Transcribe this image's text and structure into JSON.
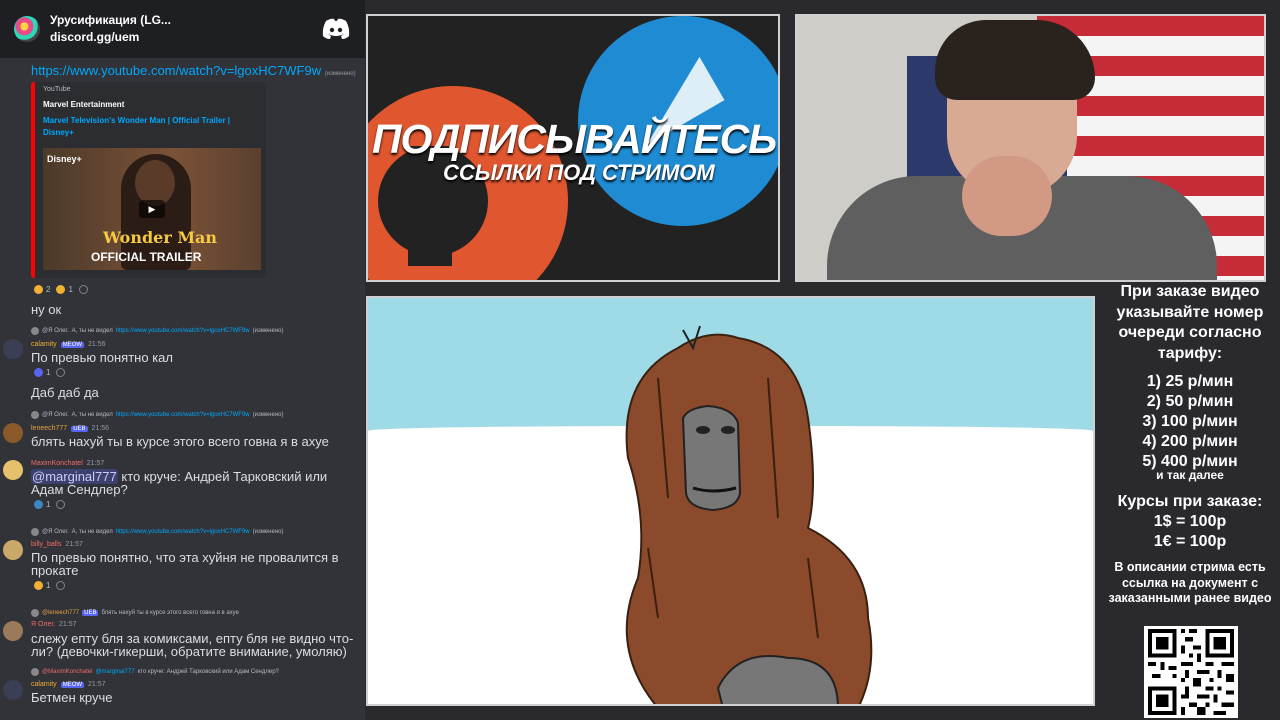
{
  "server": {
    "name": "Урусификация (LG...",
    "link": "discord.gg/uem",
    "icon": "discord-icon"
  },
  "chat": {
    "top_url": "https://www.youtube.com/watch?v=lgoxHC7WF9w",
    "top_url_suffix": "(изменено)",
    "embed": {
      "provider": "YouTube",
      "author": "Marvel Entertainment",
      "title": "Marvel Television's Wonder Man | Official Trailer | Disney+",
      "thumb_brand": "Disney+",
      "thumb_title": "Wonder Man",
      "thumb_sub": "OFFICIAL TRAILER"
    },
    "reactions_1": [
      {
        "count": "2"
      },
      {
        "count": "1"
      }
    ],
    "messages": [
      {
        "text": "ну ок"
      },
      {
        "reply_user": "@Я Олег.",
        "reply_text": "А, ты не видел",
        "reply_link": "https://www.youtube.com/watch?v=lgoxHC7WF9w",
        "reply_suffix": "(изменено)",
        "user": "calamity",
        "badge": "MEOW",
        "time": "21:56",
        "text": "По превью понятно кал",
        "react": "1"
      },
      {
        "text": "Даб даб да"
      },
      {
        "reply_user": "@Я Олег.",
        "reply_text": "А, ты не видел",
        "reply_link": "https://www.youtube.com/watch?v=lgoxHC7WF9w",
        "reply_suffix": "(изменено)",
        "user": "leneech777",
        "badge": "UEB",
        "time": "21:56",
        "text": "блять нахуй ты в курсе этого всего говна я в ахуе"
      },
      {
        "user": "MaximKonchatel",
        "time": "21:57",
        "mention": "@marginal777",
        "text": " кто круче: Андрей Тарковский или Адам Сендлер?",
        "react": "1"
      },
      {
        "reply_user": "@Я Олег.",
        "reply_text": "А, ты не видел",
        "reply_link": "https://www.youtube.com/watch?v=lgoxHC7WF9w",
        "reply_suffix": "(изменено)",
        "user": "billy_balls",
        "time": "21:57",
        "text": "По превью понятно, что эта хуйня не провалится в прокате",
        "react": "1"
      },
      {
        "reply_user": "@leneech777",
        "reply_badge": "UEB",
        "reply_text": "блять нахуй ты в курсе этого всего говна я в ахуе",
        "user": "Я Олег.",
        "time": "21:57",
        "text": "слежу епту бля за комиксами, епту бля не видно что-ли? (девочки-гикерши, обратите внимание, умоляю)"
      },
      {
        "reply_user": "@MaximKonchatel",
        "reply_mention": "@marginal777",
        "reply_text": "кто круче: Андрей Тарковский или Адам Сендлер?",
        "user": "calamity",
        "badge": "MEOW",
        "time": "21:57",
        "text": "Бетмен круче"
      }
    ]
  },
  "promo": {
    "title": "ПОДПИСЫВАЙТЕСЬ",
    "subtitle": "ССЫЛКИ ПОД СТРИМОМ"
  },
  "sidebar": {
    "heading": "При заказе видео указывайте номер очереди согласно тарифу:",
    "tariffs": [
      "1) 25 р/мин",
      "2) 50 р/мин",
      "3) 100 р/мин",
      "4) 200 р/мин",
      "5) 400 р/мин"
    ],
    "etc": "и так далее",
    "rates_heading": "Курсы при заказе:",
    "rates": [
      "1$ = 100р",
      "1€ = 100р"
    ],
    "note": "В описании стрима есть ссылка на документ с заказанными ранее видео"
  },
  "colors": {
    "link": "#00a8fc",
    "chat_bg": "#313338",
    "server_bg": "#1e1f22",
    "embed_border": "#ff0000"
  }
}
